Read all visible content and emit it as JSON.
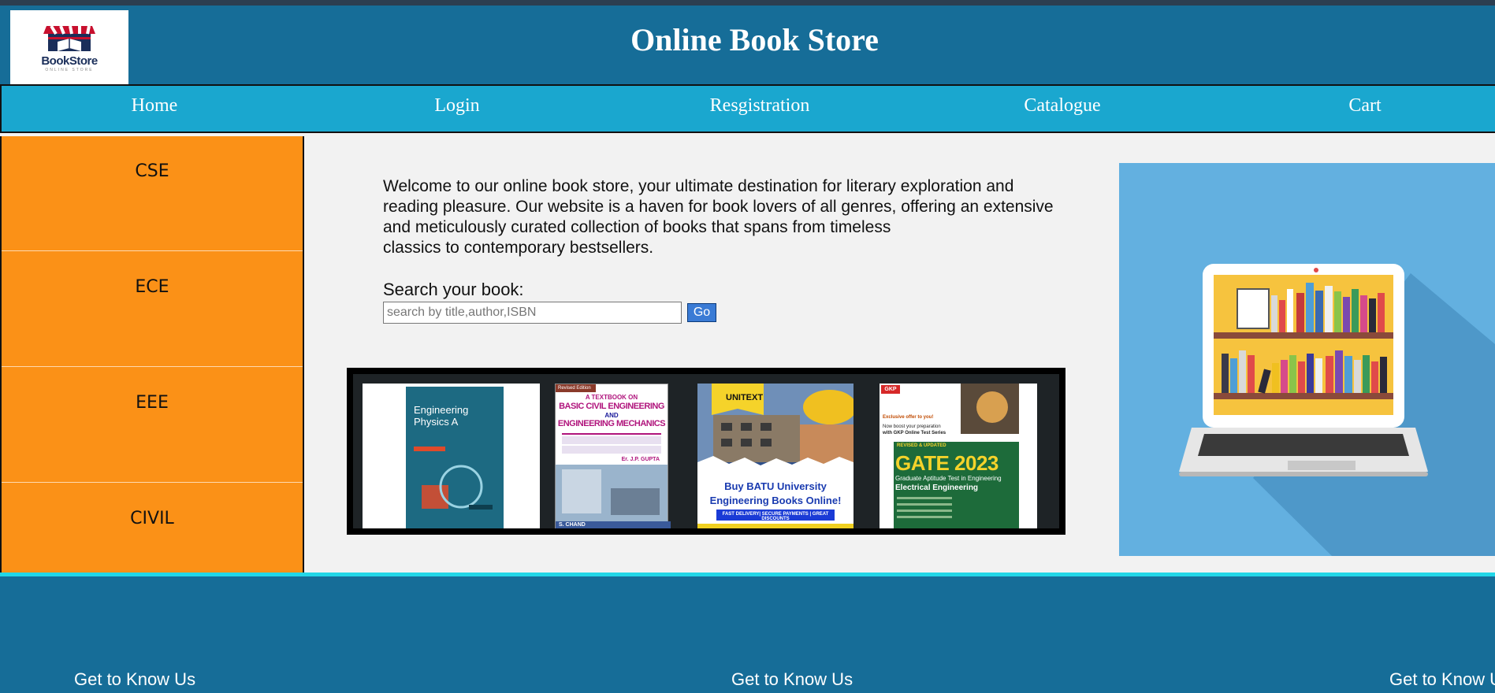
{
  "header": {
    "logo_text": "BookStore",
    "logo_subtext": "ONLINE STORE",
    "title": "Online Book Store"
  },
  "nav": {
    "items": [
      "Home",
      "Login",
      "Resgistration",
      "Catalogue",
      "Cart"
    ]
  },
  "sidebar": {
    "items": [
      "CSE",
      "ECE",
      "EEE",
      "CIVIL"
    ]
  },
  "main": {
    "welcome_lines": [
      "Welcome to our online book store, your ultimate destination for literary exploration and",
      "reading pleasure. Our website is a haven for book lovers of all genres, offering an extensive",
      "and meticulously curated collection of books that spans from timeless",
      "classics to contemporary bestsellers."
    ],
    "search_label": "Search your book:",
    "search_placeholder": "search by title,author,ISBN",
    "search_value": "",
    "go_label": "Go"
  },
  "carousel": {
    "books": [
      {
        "title_line1": "Engineering",
        "title_line2": "Physics A",
        "accent": "#1d5e74"
      },
      {
        "edition": "Revised Edition",
        "title_line1": "A TEXTBOOK ON",
        "title_line2": "BASIC CIVIL ENGINEERING",
        "title_line3": "AND",
        "title_line4": "ENGINEERING MECHANICS",
        "author": "Er. J.P. GUPTA",
        "publisher": "S. CHAND",
        "accent": "#b0147c"
      },
      {
        "brand": "UNITEXT",
        "line1": "Buy BATU University",
        "line2": "Engineering Books Online!",
        "banner": "FAST DELIVERY| SECURE PAYMENTS | GREAT DISCOUNTS",
        "accent": "#1a3bb0"
      },
      {
        "badge": "GKP",
        "kicker": "Exclusive offer to you!",
        "sub1": "Now boost your preparation",
        "sub2": "with GKP Online Test Series",
        "tag": "REVISED & UPDATED",
        "title": "GATE 2023",
        "subtitle": "Graduate Aptitude Test in Engineering",
        "branch": "Electrical Engineering",
        "accent": "#1d6b3a"
      }
    ]
  },
  "footer": {
    "headings": [
      "Get to Know Us",
      "Get to Know Us",
      "Get to Know Us"
    ]
  },
  "colors": {
    "header": "#166d98",
    "nav": "#1aa7cf",
    "sidebar": "#fb9117",
    "footer_line": "#21d7e8",
    "go_button": "#3a7bd5",
    "hero_bg": "#63b0e0"
  }
}
